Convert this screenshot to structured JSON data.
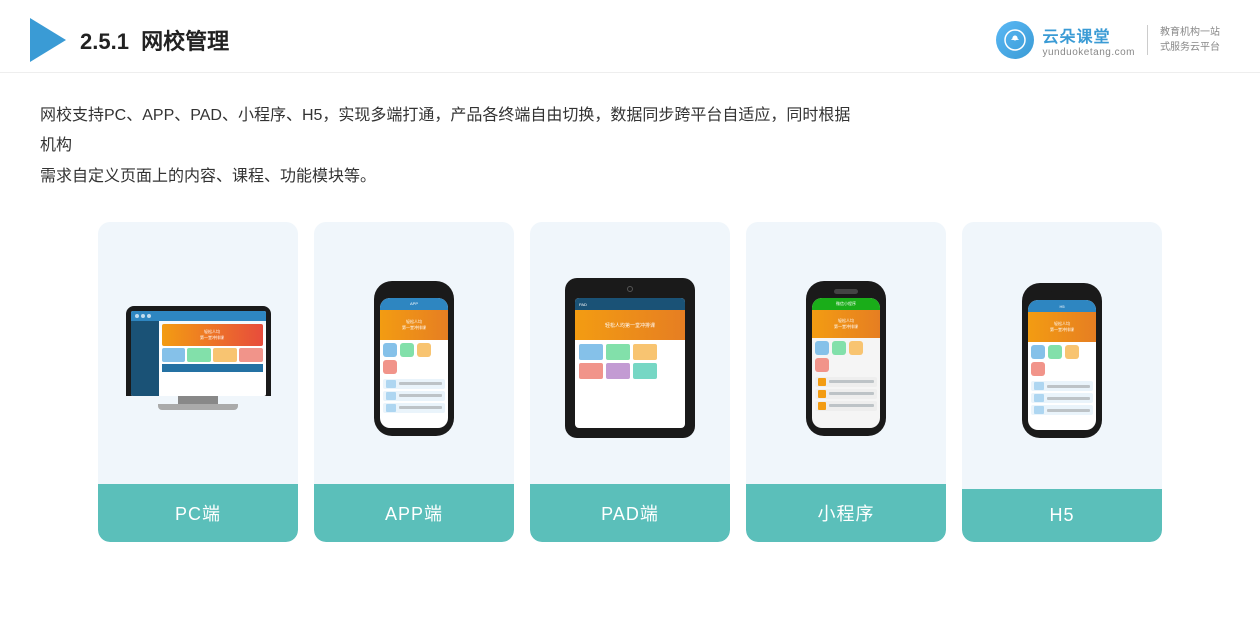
{
  "header": {
    "section_number": "2.5.1",
    "title": "网校管理",
    "brand": {
      "name": "云朵课堂",
      "url": "yunduoketang.com",
      "slogan_line1": "教育机构一站",
      "slogan_line2": "式服务云平台"
    }
  },
  "description": {
    "text_line1": "网校支持PC、APP、PAD、小程序、H5，实现多端打通，产品各终端自由切换，数据同步跨平台自适应，同时根据机构",
    "text_line2": "需求自定义页面上的内容、课程、功能模块等。"
  },
  "cards": [
    {
      "id": "pc",
      "label": "PC端",
      "type": "pc"
    },
    {
      "id": "app",
      "label": "APP端",
      "type": "phone"
    },
    {
      "id": "pad",
      "label": "PAD端",
      "type": "pad"
    },
    {
      "id": "mini",
      "label": "小程序",
      "type": "wechat"
    },
    {
      "id": "h5",
      "label": "H5",
      "type": "phone"
    }
  ],
  "colors": {
    "accent": "#5bbfba",
    "header_blue": "#3a9bd5",
    "title_normal": "#333333",
    "bg_card": "#f0f6fb"
  }
}
